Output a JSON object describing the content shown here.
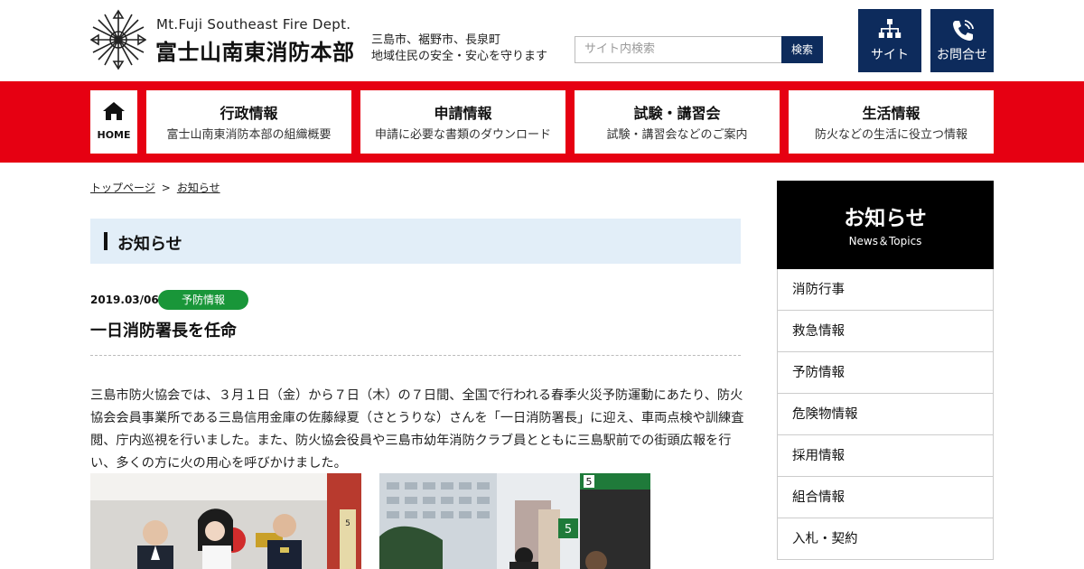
{
  "header": {
    "site_name_en": "Mt.Fuji Southeast Fire Dept.",
    "site_name_jp": "富士山南東消防本部",
    "tagline_line1": "三島市、裾野市、長泉町",
    "tagline_line2": "地域住民の安全・安心を守ります",
    "search_placeholder": "サイト内検索",
    "search_button": "検索",
    "sitemap_label": "サイト",
    "contact_label": "お問合せ",
    "sitemap_icon": "sitemap-icon",
    "contact_icon": "phone-icon"
  },
  "nav": {
    "home_label": "HOME",
    "home_icon": "home-icon",
    "items": [
      {
        "title": "行政情報",
        "sub": "富士山南東消防本部の組織概要"
      },
      {
        "title": "申請情報",
        "sub": "申請に必要な書類のダウンロード"
      },
      {
        "title": "試験・講習会",
        "sub": "試験・講習会などのご案内"
      },
      {
        "title": "生活情報",
        "sub": "防火などの生活に役立つ情報"
      }
    ]
  },
  "breadcrumb": {
    "home": "トップページ",
    "separator": ">",
    "current": "お知らせ"
  },
  "page_title": "お知らせ",
  "article": {
    "date": "2019.03/06",
    "category": "予防情報",
    "title": "一日消防署長を任命",
    "body": "三島市防火協会では、３月１日（金）から７日（木）の７日間、全国で行われる春季火災予防運動にあたり、防火協会会員事業所である三島信用金庫の佐藤緑夏（さとうりな）さんを「一日消防署長」に迎え、車両点検や訓練査閲、庁内巡視を行いました。また、防火協会役員や三島市幼年消防クラブ員とともに三島駅前での街頭広報を行い、多くの方に火の用心を呼びかけました。",
    "photo1_sign": "5",
    "photo2_sign_top": "5",
    "photo2_sign_bottom": "5"
  },
  "sidebar": {
    "title_jp": "お知らせ",
    "title_en": "News＆Topics",
    "items": [
      "消防行事",
      "救急情報",
      "予防情報",
      "危険物情報",
      "採用情報",
      "組合情報",
      "入札・契約"
    ]
  },
  "colors": {
    "navy": "#0d2b5c",
    "red": "#e60012",
    "green_badge": "#199639",
    "title_bg": "#e2eef8"
  }
}
